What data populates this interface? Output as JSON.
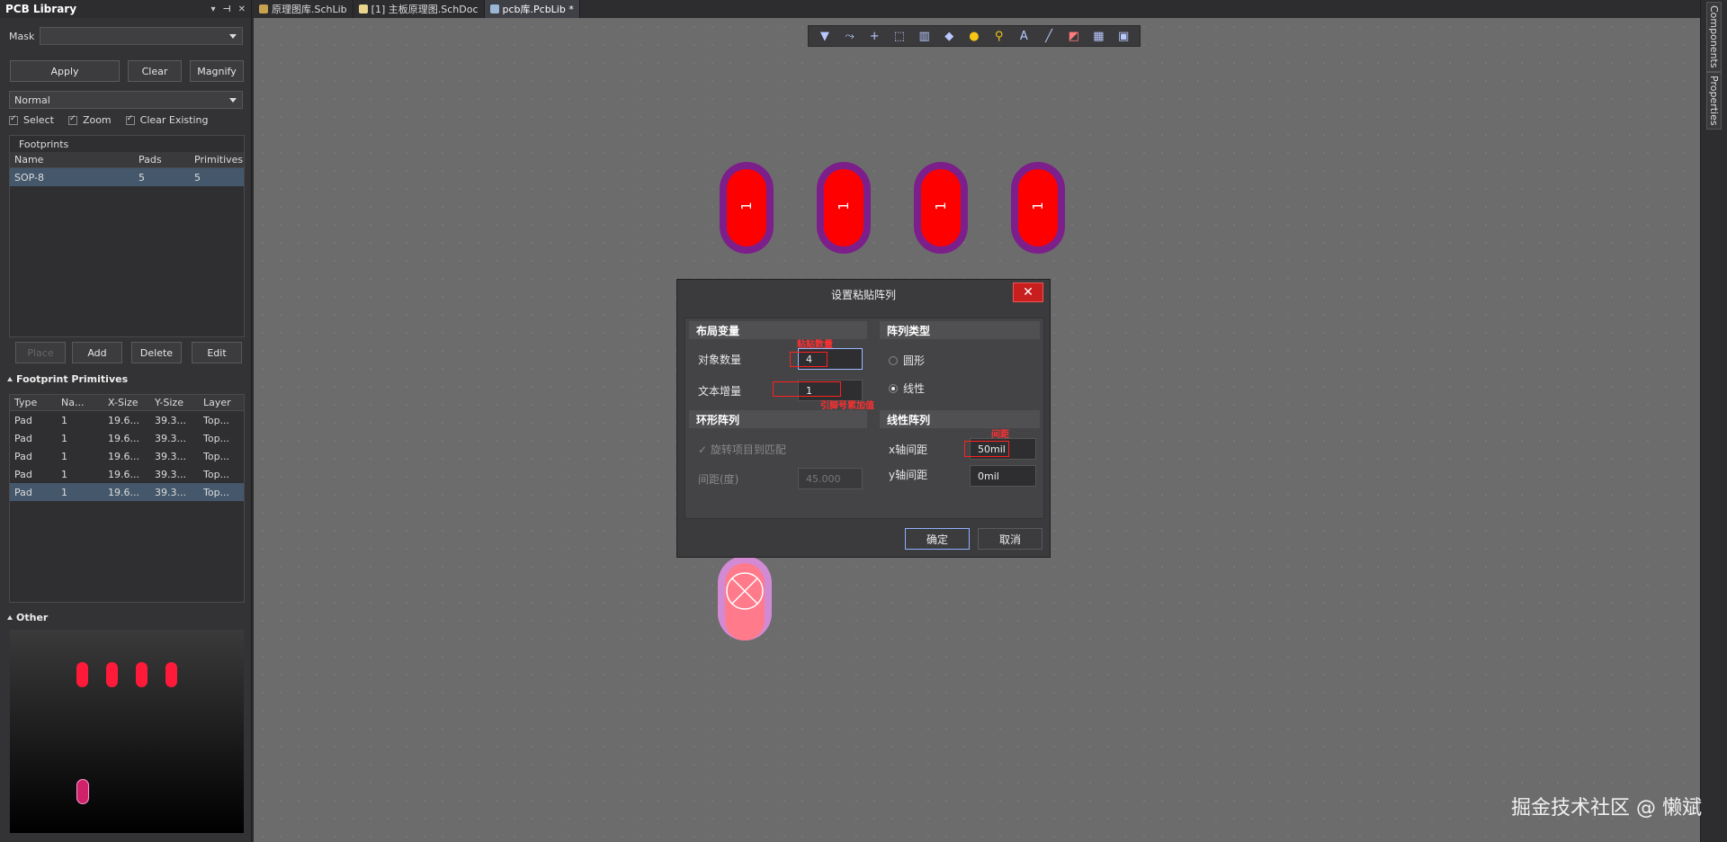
{
  "left_panel": {
    "title": "PCB Library",
    "mask_label": "Mask",
    "mask_value": "",
    "buttons": {
      "apply": "Apply",
      "clear": "Clear",
      "magnify": "Magnify"
    },
    "mode_value": "Normal",
    "checks": {
      "select": "Select",
      "zoom": "Zoom",
      "clear_existing": "Clear Existing"
    },
    "footprints": {
      "title": "Footprints",
      "columns": [
        "Name",
        "Pads",
        "Primitives"
      ],
      "rows": [
        {
          "name": "SOP-8",
          "pads": "5",
          "primitives": "5"
        }
      ]
    },
    "actions": {
      "place": "Place",
      "add": "Add",
      "delete": "Delete",
      "edit": "Edit"
    },
    "primitives": {
      "title": "Footprint Primitives",
      "columns": [
        "Type",
        "Na...",
        "X-Size",
        "Y-Size",
        "Layer"
      ],
      "rows": [
        {
          "type": "Pad",
          "name": "1",
          "x": "19.6...",
          "y": "39.3...",
          "layer": "Top..."
        },
        {
          "type": "Pad",
          "name": "1",
          "x": "19.6...",
          "y": "39.3...",
          "layer": "Top..."
        },
        {
          "type": "Pad",
          "name": "1",
          "x": "19.6...",
          "y": "39.3...",
          "layer": "Top..."
        },
        {
          "type": "Pad",
          "name": "1",
          "x": "19.6...",
          "y": "39.3...",
          "layer": "Top..."
        },
        {
          "type": "Pad",
          "name": "1",
          "x": "19.6...",
          "y": "39.3...",
          "layer": "Top..."
        }
      ]
    },
    "other_title": "Other"
  },
  "tabs": [
    {
      "label": "原理图库.SchLib"
    },
    {
      "label": "[1] 主板原理图.SchDoc"
    },
    {
      "label": "pcb库.PcbLib *"
    }
  ],
  "right_tabs": {
    "components": "Components",
    "properties": "Properties"
  },
  "pads": [
    {
      "label": "1"
    },
    {
      "label": "1"
    },
    {
      "label": "1"
    },
    {
      "label": "1"
    }
  ],
  "dialog": {
    "title": "设置粘贴阵列",
    "close": "✕",
    "layout_group": "布局变量",
    "object_count_label": "对象数量",
    "object_count_value": "4",
    "text_increment_label": "文本增量",
    "text_increment_value": "1",
    "array_type_group": "阵列类型",
    "radio_circular": "圆形",
    "radio_linear": "线性",
    "circular_group": "环形阵列",
    "rotate_label": "旋转项目到匹配",
    "spacing_deg_label": "间距(度)",
    "spacing_deg_value": "45.000",
    "linear_group": "线性阵列",
    "x_spacing_label": "x轴间距",
    "x_spacing_value": "50mil",
    "y_spacing_label": "y轴间距",
    "y_spacing_value": "0mil",
    "ok": "确定",
    "cancel": "取消",
    "annotations": {
      "count": "粘贴数量",
      "increment": "引脚号累加值",
      "spacing": "间距"
    }
  },
  "watermark": "掘金技术社区 @ 懒斌"
}
